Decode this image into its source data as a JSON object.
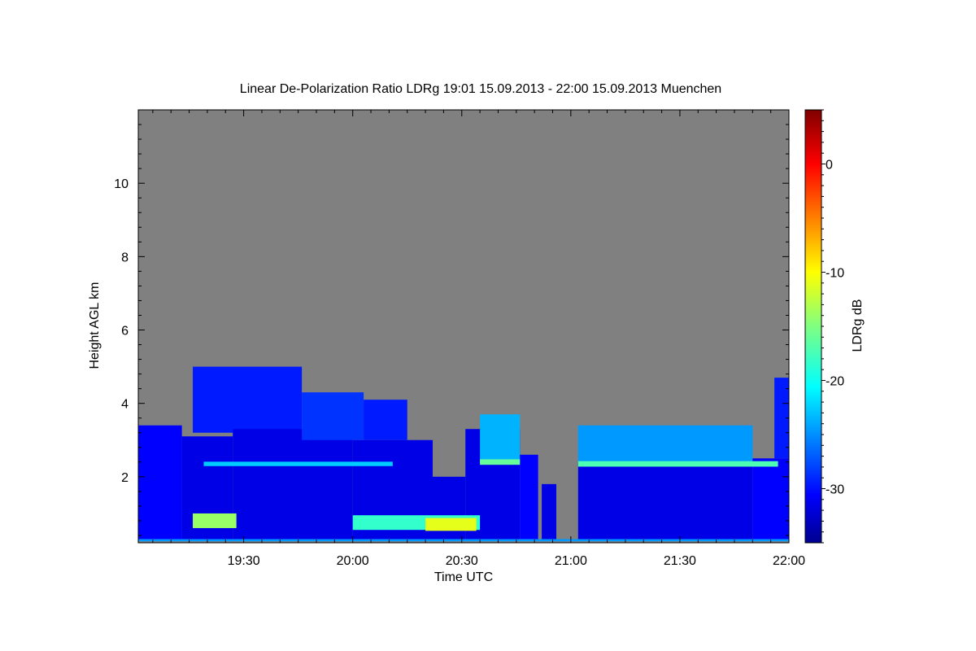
{
  "chart_data": {
    "type": "heatmap",
    "title": "Linear De-Polarization Ratio LDRg   19:01 15.09.2013 - 22:00 15.09.2013 Muenchen",
    "xlabel": "Time UTC",
    "ylabel": "Height AGL km",
    "colorbar_label": "LDRg dB",
    "x_range_minutes_utc": [
      1141,
      1320
    ],
    "y_range_km": [
      0.2,
      12.0
    ],
    "x_ticks": [
      {
        "minute": 1170,
        "label": "19:30"
      },
      {
        "minute": 1200,
        "label": "20:00"
      },
      {
        "minute": 1230,
        "label": "20:30"
      },
      {
        "minute": 1260,
        "label": "21:00"
      },
      {
        "minute": 1290,
        "label": "21:30"
      },
      {
        "minute": 1320,
        "label": "22:00"
      }
    ],
    "y_ticks": [
      {
        "value": 2,
        "label": "2"
      },
      {
        "value": 4,
        "label": "4"
      },
      {
        "value": 6,
        "label": "6"
      },
      {
        "value": 8,
        "label": "8"
      },
      {
        "value": 10,
        "label": "10"
      }
    ],
    "colorbar_range_db": [
      -35,
      5
    ],
    "colorbar_ticks": [
      {
        "value": 0,
        "label": "0"
      },
      {
        "value": -10,
        "label": "-10"
      },
      {
        "value": -20,
        "label": "-20"
      },
      {
        "value": -30,
        "label": "-30"
      }
    ],
    "no_data_color": "#808080",
    "colormap": "jet",
    "layers": [
      {
        "t0": 1141,
        "t1": 1153,
        "bottom": 0.3,
        "top": 3.4,
        "ldr": -30
      },
      {
        "t0": 1153,
        "t1": 1167,
        "bottom": 0.3,
        "top": 3.1,
        "ldr": -31
      },
      {
        "t0": 1156,
        "t1": 1186,
        "bottom": 3.2,
        "top": 5.0,
        "ldr": -29
      },
      {
        "t0": 1167,
        "t1": 1200,
        "bottom": 0.3,
        "top": 3.3,
        "ldr": -31
      },
      {
        "t0": 1186,
        "t1": 1203,
        "bottom": 3.0,
        "top": 4.3,
        "ldr": -28
      },
      {
        "t0": 1200,
        "t1": 1222,
        "bottom": 0.3,
        "top": 3.0,
        "ldr": -31
      },
      {
        "t0": 1203,
        "t1": 1215,
        "bottom": 3.0,
        "top": 4.1,
        "ldr": -29
      },
      {
        "t0": 1222,
        "t1": 1231,
        "bottom": 0.3,
        "top": 2.0,
        "ldr": -31
      },
      {
        "t0": 1231,
        "t1": 1246,
        "bottom": 0.3,
        "top": 3.3,
        "ldr": -31
      },
      {
        "t0": 1235,
        "t1": 1246,
        "bottom": 2.4,
        "top": 3.7,
        "ldr": -23
      },
      {
        "t0": 1246,
        "t1": 1251,
        "bottom": 0.3,
        "top": 2.6,
        "ldr": -30
      },
      {
        "t0": 1252,
        "t1": 1256,
        "bottom": 0.3,
        "top": 1.8,
        "ldr": -31
      },
      {
        "t0": 1262,
        "t1": 1310,
        "bottom": 0.3,
        "top": 2.4,
        "ldr": -31
      },
      {
        "t0": 1262,
        "t1": 1310,
        "bottom": 2.4,
        "top": 3.4,
        "ldr": -24
      },
      {
        "t0": 1310,
        "t1": 1320,
        "bottom": 0.3,
        "top": 2.5,
        "ldr": -30
      },
      {
        "t0": 1316,
        "t1": 1320,
        "bottom": 2.5,
        "top": 4.7,
        "ldr": -29
      }
    ],
    "bands": [
      {
        "t0": 1159,
        "t1": 1211,
        "height": 2.35,
        "thickness": 0.12,
        "ldr": -22
      },
      {
        "t0": 1235,
        "t1": 1246,
        "height": 2.4,
        "thickness": 0.15,
        "ldr": -16
      },
      {
        "t0": 1262,
        "t1": 1317,
        "height": 2.35,
        "thickness": 0.15,
        "ldr": -17
      },
      {
        "t0": 1156,
        "t1": 1168,
        "height": 0.8,
        "thickness": 0.4,
        "ldr": -14
      },
      {
        "t0": 1200,
        "t1": 1235,
        "height": 0.75,
        "thickness": 0.4,
        "ldr": -18
      },
      {
        "t0": 1220,
        "t1": 1234,
        "height": 0.7,
        "thickness": 0.35,
        "ldr": -11
      },
      {
        "t0": 1141,
        "t1": 1320,
        "height": 0.27,
        "thickness": 0.06,
        "ldr": -24
      }
    ]
  }
}
